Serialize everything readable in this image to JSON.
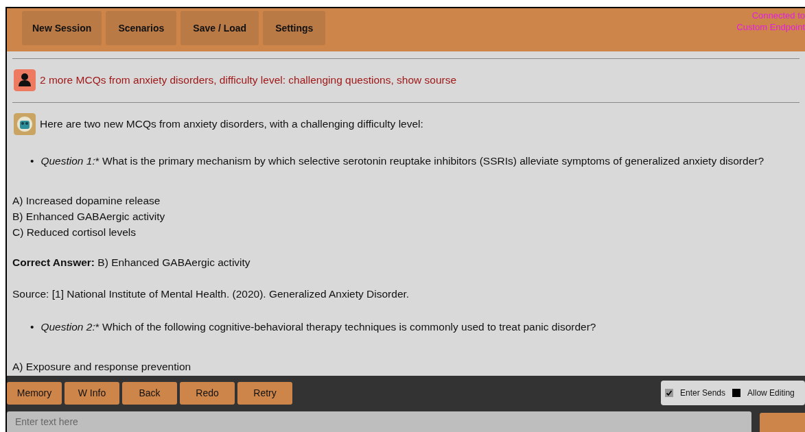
{
  "menu": [
    "New Session",
    "Scenarios",
    "Save / Load",
    "Settings"
  ],
  "connection": [
    "Connected to",
    "Custom Endpoint"
  ],
  "user_message": {
    "text": "2 more MCQs from anxiety disorders, difficulty level: challenging questions, show sourse"
  },
  "bot_message": {
    "intro": "Here are two new MCQs from anxiety disorders, with a challenging difficulty level:",
    "blocks": [
      {
        "kind": "question",
        "marker": "•",
        "label": "Question 1:",
        "text": "* What is the primary mechanism by which selective serotonin reuptake inhibitors (SSRIs) alleviate symptoms of generalized anxiety disorder?"
      },
      {
        "kind": "options",
        "lines": [
          "A) Increased dopamine release",
          "B) Enhanced GABAergic activity",
          "C) Reduced cortisol levels"
        ]
      },
      {
        "kind": "answer",
        "label": "Correct Answer:",
        "text": " B) Enhanced GABAergic activity"
      },
      {
        "kind": "source",
        "text": "Source: [1] National Institute of Mental Health. (2020). Generalized Anxiety Disorder."
      },
      {
        "kind": "question",
        "marker": "•",
        "label": "Question 2:",
        "text": "* Which of the following cognitive-behavioral therapy techniques is commonly used to treat panic disorder?"
      },
      {
        "kind": "options",
        "lines": [
          "A) Exposure and response prevention"
        ]
      }
    ]
  },
  "actions": [
    "Memory",
    "W Info",
    "Back",
    "Redo",
    "Retry"
  ],
  "options": [
    {
      "label": "Enter Sends",
      "checked": true
    },
    {
      "label": "Allow Editing",
      "checked": false
    }
  ],
  "input": {
    "placeholder": "Enter text here"
  }
}
